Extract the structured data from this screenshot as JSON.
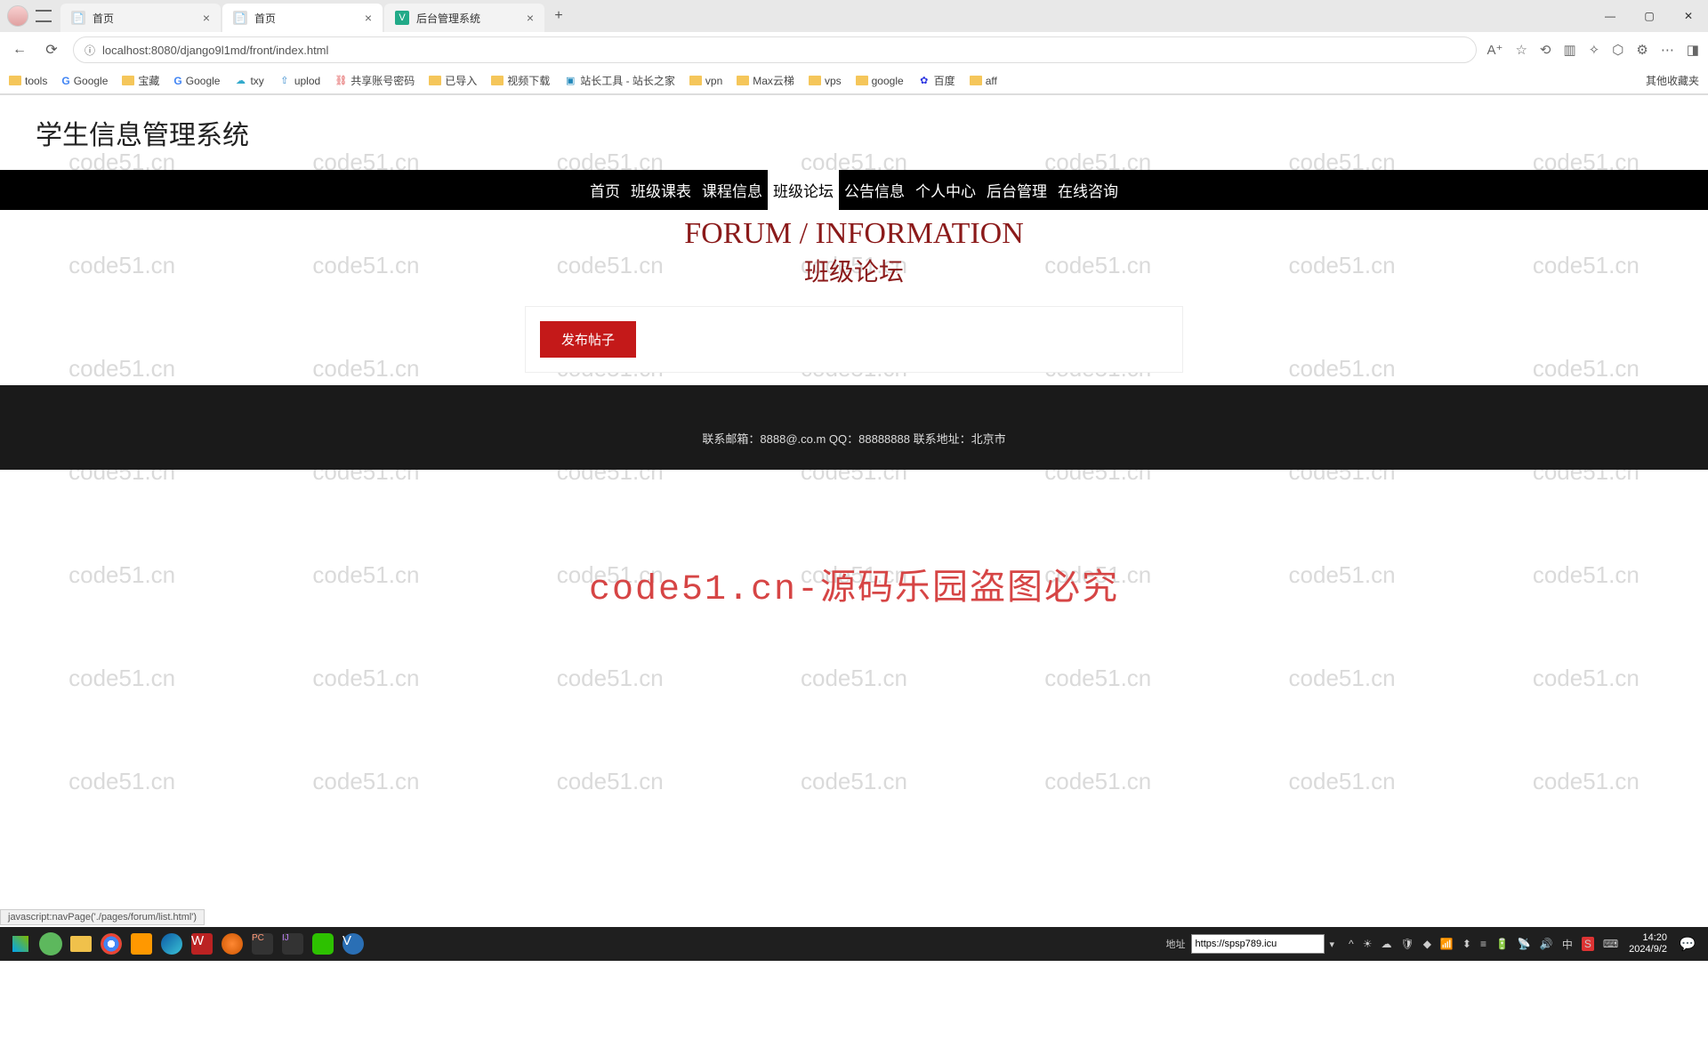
{
  "browser": {
    "tabs": [
      {
        "title": "首页",
        "active": false
      },
      {
        "title": "首页",
        "active": true
      },
      {
        "title": "后台管理系统",
        "active": false
      }
    ],
    "url": "localhost:8080/django9l1md/front/index.html",
    "bookmarks": [
      "tools",
      "Google",
      "宝藏",
      "Google",
      "txy",
      "uplod",
      "共享账号密码",
      "已导入",
      "视频下载",
      "站长工具 - 站长之家",
      "vpn",
      "Max云梯",
      "vps",
      "google",
      "百度",
      "aff"
    ],
    "other_bookmarks": "其他收藏夹",
    "status_text": "javascript:navPage('./pages/forum/list.html')"
  },
  "site": {
    "title": "学生信息管理系统",
    "nav": [
      "首页",
      "班级课表",
      "课程信息",
      "班级论坛",
      "公告信息",
      "个人中心",
      "后台管理",
      "在线咨询"
    ],
    "nav_active_index": 3,
    "heading_en": "FORUM / INFORMATION",
    "heading_cn": "班级论坛",
    "post_button": "发布帖子",
    "footer": "联系邮箱：8888@.co.m QQ：88888888 联系地址：北京市"
  },
  "watermark": {
    "small": "code51.cn",
    "big": "code51.cn-源码乐园盗图必究"
  },
  "taskbar": {
    "addr_label": "地址",
    "addr_value": "https://spsp789.icu",
    "time": "14:20",
    "date": "2024/9/2"
  }
}
